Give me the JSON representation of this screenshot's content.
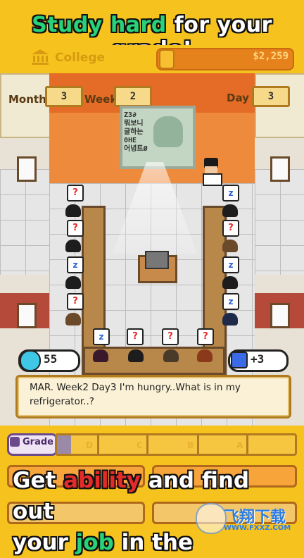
{
  "banner": {
    "title_part1": "Study hard",
    "title_part2": " for your grade!"
  },
  "status": {
    "location": "College",
    "money": "$2,259"
  },
  "calendar": {
    "month_label": "Month",
    "month_value": "3",
    "week_label": "Week",
    "week_value": "2",
    "day_label": "Day",
    "day_value": "3"
  },
  "blackboard": {
    "text": "Z3∂\n뭐보니\n글하는\n0HE\n어녕트Ø"
  },
  "students": {
    "left_column_bubbles": [
      "?",
      "?",
      "z",
      "?"
    ],
    "right_column_bubbles": [
      "z",
      "?",
      "z",
      "z"
    ],
    "front_row_bubbles": [
      "z",
      "?",
      "?",
      "?"
    ]
  },
  "chips": {
    "happiness_icon": "droplet-icon",
    "happiness_value": "55",
    "note_icon": "note-icon",
    "note_value": "+3"
  },
  "dialog": {
    "text": "MAR. Week2 Day3 I'm hungry..What is in my refrigerator..?"
  },
  "grade": {
    "label": "Grade",
    "letters": [
      "D",
      "C",
      "B",
      "A"
    ],
    "accent": "#6a4a8a"
  },
  "caption": {
    "line1_a": "Get ",
    "line1_b": "ability",
    "line1_c": " and find out",
    "line2_a": "your ",
    "line2_b": "job",
    "line2_c": " in the"
  },
  "watermark": {
    "text": "飞翔下载",
    "url": "WWW.FXXZ.COM"
  },
  "colors": {
    "background": "#f6c31e",
    "green": "#27d37a",
    "red": "#e52a2a"
  }
}
